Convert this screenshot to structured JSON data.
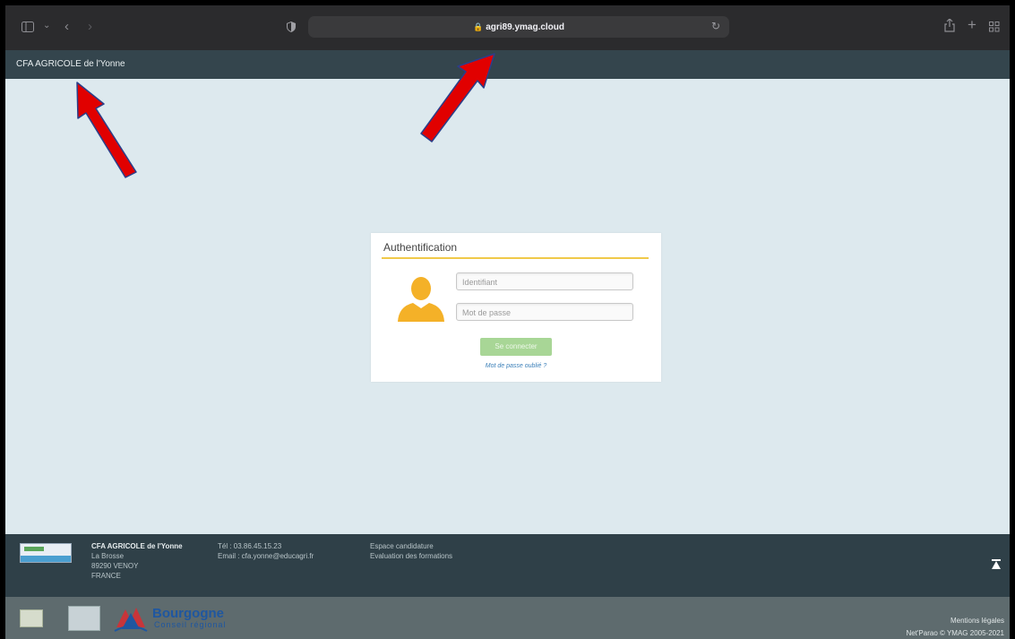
{
  "browser": {
    "url": "agri89.ymag.cloud",
    "lock_icon": "lock-icon",
    "icons": [
      "sidebar-icon",
      "chevron-down-icon",
      "back-icon",
      "forward-icon",
      "shield-icon",
      "reload-icon",
      "share-icon",
      "new-tab-icon",
      "tab-overview-icon"
    ]
  },
  "header": {
    "site_title": "CFA AGRICOLE de l'Yonne"
  },
  "auth": {
    "title": "Authentification",
    "username_placeholder": "Identifiant",
    "password_placeholder": "Mot de passe",
    "login_label": "Se connecter",
    "forgot_label": "Mot de passe oublié ?"
  },
  "footer": {
    "org_name": "CFA AGRICOLE de l'Yonne",
    "address_line1": "La Brosse",
    "address_line2": "89290 VENOY",
    "address_line3": "FRANCE",
    "phone": "Tél : 03.86.45.15.23",
    "email": "Email : cfa.yonne@educagri.fr",
    "link_candidature": "Espace candidature",
    "link_evaluation": "Evaluation des formations",
    "scroll_top_icon": "arrow-to-top-icon"
  },
  "bottom_bar": {
    "bourgogne_name": "Bourgogne",
    "bourgogne_sub": "Conseil régional",
    "mentions": "Mentions légales",
    "copyright": "Net'Parao © YMAG 2005-2021"
  },
  "colors": {
    "header_bg": "#34454d",
    "page_bg": "#dde9ee",
    "accent_rule": "#f0c94a",
    "login_button": "#a8d696",
    "annotation_arrow": "#e10000"
  }
}
